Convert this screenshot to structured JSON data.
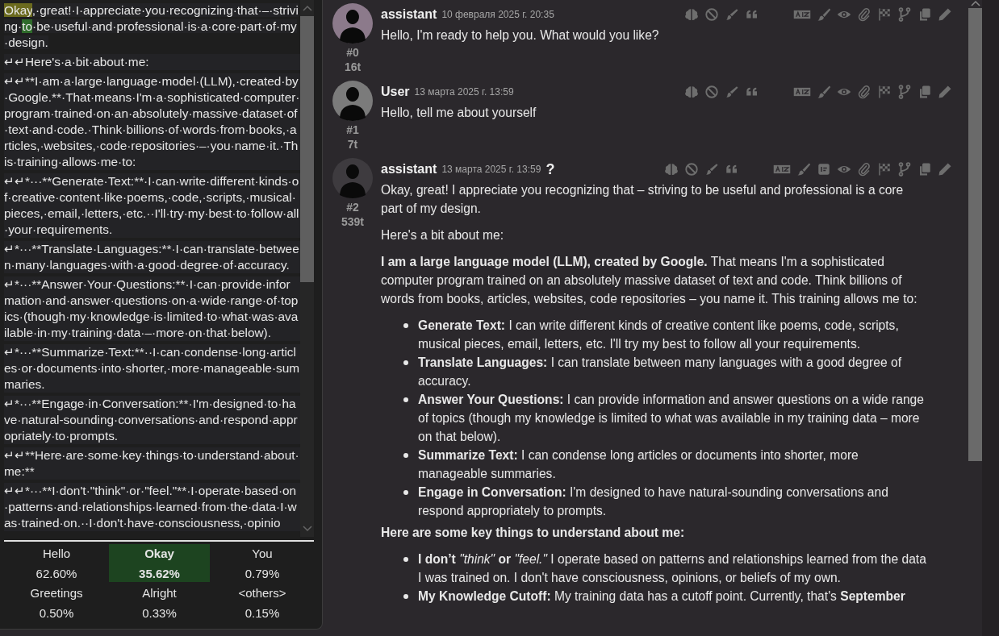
{
  "token_view": {
    "paragraphs": [
      {
        "parts": [
          {
            "text": "Okay",
            "kind": "chosen"
          },
          {
            "text": ",·great!·I·appreciate·you·recognizing·that·–·striving·",
            "kind": "plain"
          },
          {
            "text": "to",
            "kind": "alt"
          },
          {
            "text": "·be·useful·and·professional·is·a·core·part·of·my·design.",
            "kind": "plain"
          }
        ]
      },
      {
        "parts": [
          {
            "text": "↵↵Here's·a·bit·about·me:",
            "kind": "plain"
          }
        ]
      },
      {
        "parts": [
          {
            "text": "↵↵**I·am·a·large·language·model·(LLM),·created·by·Google.**·That·means·I'm·a·sophisticated·computer·program·trained·on·an·absolutely·massive·dataset·of·text·and·code.·Think·billions·of·words·from·books,·articles,·websites,·code·repositories·–·you·name·it.·This·training·allows·me·to:",
            "kind": "plain"
          }
        ]
      },
      {
        "parts": [
          {
            "text": "↵↵*···**Generate·Text:**·I·can·write·different·kinds·of·creative·content·like·poems,·code,·scripts,·musical·pieces,·email,·letters,·etc.··I'll·try·my·best·to·follow·all·your·requirements.",
            "kind": "plain"
          }
        ]
      },
      {
        "parts": [
          {
            "text": "↵*···**Translate·Languages:**·I·can·translate·between·many·languages·with·a·good·degree·of·accuracy.",
            "kind": "plain"
          }
        ]
      },
      {
        "parts": [
          {
            "text": "↵*···**Answer·Your·Questions:**·I·can·provide·information·and·answer·questions·on·a·wide·range·of·topics·(though·my·knowledge·is·limited·to·what·was·available·in·my·training·data·–·more·on·that·below).",
            "kind": "plain"
          }
        ]
      },
      {
        "parts": [
          {
            "text": "↵*···**Summarize·Text:**··I·can·condense·long·articles·or·documents·into·shorter,·more·manageable·summaries.",
            "kind": "plain"
          }
        ]
      },
      {
        "parts": [
          {
            "text": "↵*···**Engage·in·Conversation:**·I'm·designed·to·have·natural-sounding·conversations·and·respond·appropriately·to·prompts.",
            "kind": "plain"
          }
        ]
      },
      {
        "parts": [
          {
            "text": "↵↵**Here·are·some·key·things·to·understand·about·me:**",
            "kind": "plain"
          }
        ]
      },
      {
        "parts": [
          {
            "text": "↵↵*···**I·don't·\"think\"·or·\"feel.\"**·I·operate·based·on·patterns·and·relationships·learned·from·the·data·I·was·trained·on.··I·don't·have·consciousness,·opinio",
            "kind": "plain"
          }
        ]
      }
    ],
    "candidates": [
      {
        "token": "Hello",
        "prob": "62.60%",
        "selected": false
      },
      {
        "token": "Okay",
        "prob": "35.62%",
        "selected": true
      },
      {
        "token": "You",
        "prob": "0.79%",
        "selected": false
      },
      {
        "token": "Greetings",
        "prob": "0.50%",
        "selected": false
      },
      {
        "token": "Alright",
        "prob": "0.33%",
        "selected": false
      },
      {
        "token": "<others>",
        "prob": "0.15%",
        "selected": false
      }
    ]
  },
  "messages": [
    {
      "name": "assistant",
      "date": "10 февраля 2025 г. 20:35",
      "index": "#0",
      "tokens": "16t",
      "color": "#8c7a8b",
      "notes_button": false,
      "body": [
        {
          "kind": "p",
          "text": "Hello, I'm ready to help you. What would you like?"
        }
      ]
    },
    {
      "name": "User",
      "date": "13 марта 2025 г. 13:59",
      "index": "#1",
      "tokens": "7t",
      "color": "#7b7b7b",
      "notes_button": false,
      "body": [
        {
          "kind": "p",
          "text": "Hello, tell me about yourself"
        }
      ]
    },
    {
      "name": "assistant",
      "date": "13 марта 2025 г. 13:59",
      "mark": "?",
      "index": "#2",
      "tokens": "539t",
      "color": "#3e3b3f",
      "notes_button": true,
      "body": [
        {
          "kind": "p",
          "text": "Okay, great! I appreciate you recognizing that – striving to be useful and professional is a core part of my design."
        },
        {
          "kind": "p",
          "text": "Here's a bit about me:"
        },
        {
          "kind": "p",
          "text": "**I am a large language model (LLM), created by Google.** That means I'm a sophisticated computer program trained on an absolutely massive dataset of text and code. Think billions of words from books, articles, websites, code repositories – you name it. This training allows me to:"
        },
        {
          "kind": "list",
          "items": [
            "**Generate Text:** I can write different kinds of creative content like poems, code, scripts, musical pieces, email, letters, etc. I'll try my best to follow all your requirements.",
            "**Translate Languages:** I can translate between many languages with a good degree of accuracy.",
            "**Answer Your Questions:** I can provide information and answer questions on a wide range of topics (though my knowledge is limited to what was available in my training data – more on that below).",
            "**Summarize Text:** I can condense long articles or documents into shorter, more manageable summaries.",
            "**Engage in Conversation:** I'm designed to have natural-sounding conversations and respond appropriately to prompts."
          ]
        },
        {
          "kind": "heading",
          "text": "Here are some key things to understand about me:"
        },
        {
          "kind": "list",
          "items": [
            "**I don’t** *\"think\"* **or** *\"feel.\"* I operate based on patterns and relationships learned from the data I was trained on. I don't have consciousness, opinions, or beliefs of my own.",
            "**My Knowledge Cutoff:** My training data has a cutoff point. Currently, that's **September**"
          ]
        }
      ]
    }
  ]
}
